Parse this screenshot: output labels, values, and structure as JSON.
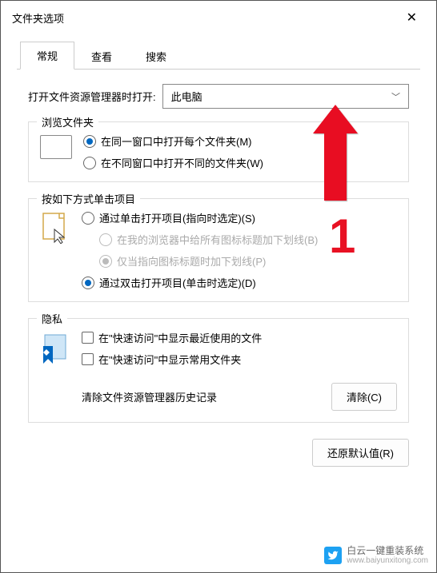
{
  "window": {
    "title": "文件夹选项"
  },
  "tabs": {
    "general": "常规",
    "view": "查看",
    "search": "搜索"
  },
  "open_with": {
    "label": "打开文件资源管理器时打开:",
    "value": "此电脑"
  },
  "browse": {
    "title": "浏览文件夹",
    "same_window": "在同一窗口中打开每个文件夹(M)",
    "new_window": "在不同窗口中打开不同的文件夹(W)"
  },
  "click": {
    "title": "按如下方式单击项目",
    "single": "通过单击打开项目(指向时选定)(S)",
    "underline_all": "在我的浏览器中给所有图标标题加下划线(B)",
    "underline_point": "仅当指向图标标题时加下划线(P)",
    "double": "通过双击打开项目(单击时选定)(D)"
  },
  "privacy": {
    "title": "隐私",
    "recent": "在\"快速访问\"中显示最近使用的文件",
    "frequent": "在\"快速访问\"中显示常用文件夹",
    "clear_label": "清除文件资源管理器历史记录",
    "clear_button": "清除(C)"
  },
  "restore": "还原默认值(R)",
  "annotation": {
    "number": "1"
  },
  "watermark": {
    "text": "白云一键重装系统",
    "url": "www.baiyunxitong.com"
  }
}
